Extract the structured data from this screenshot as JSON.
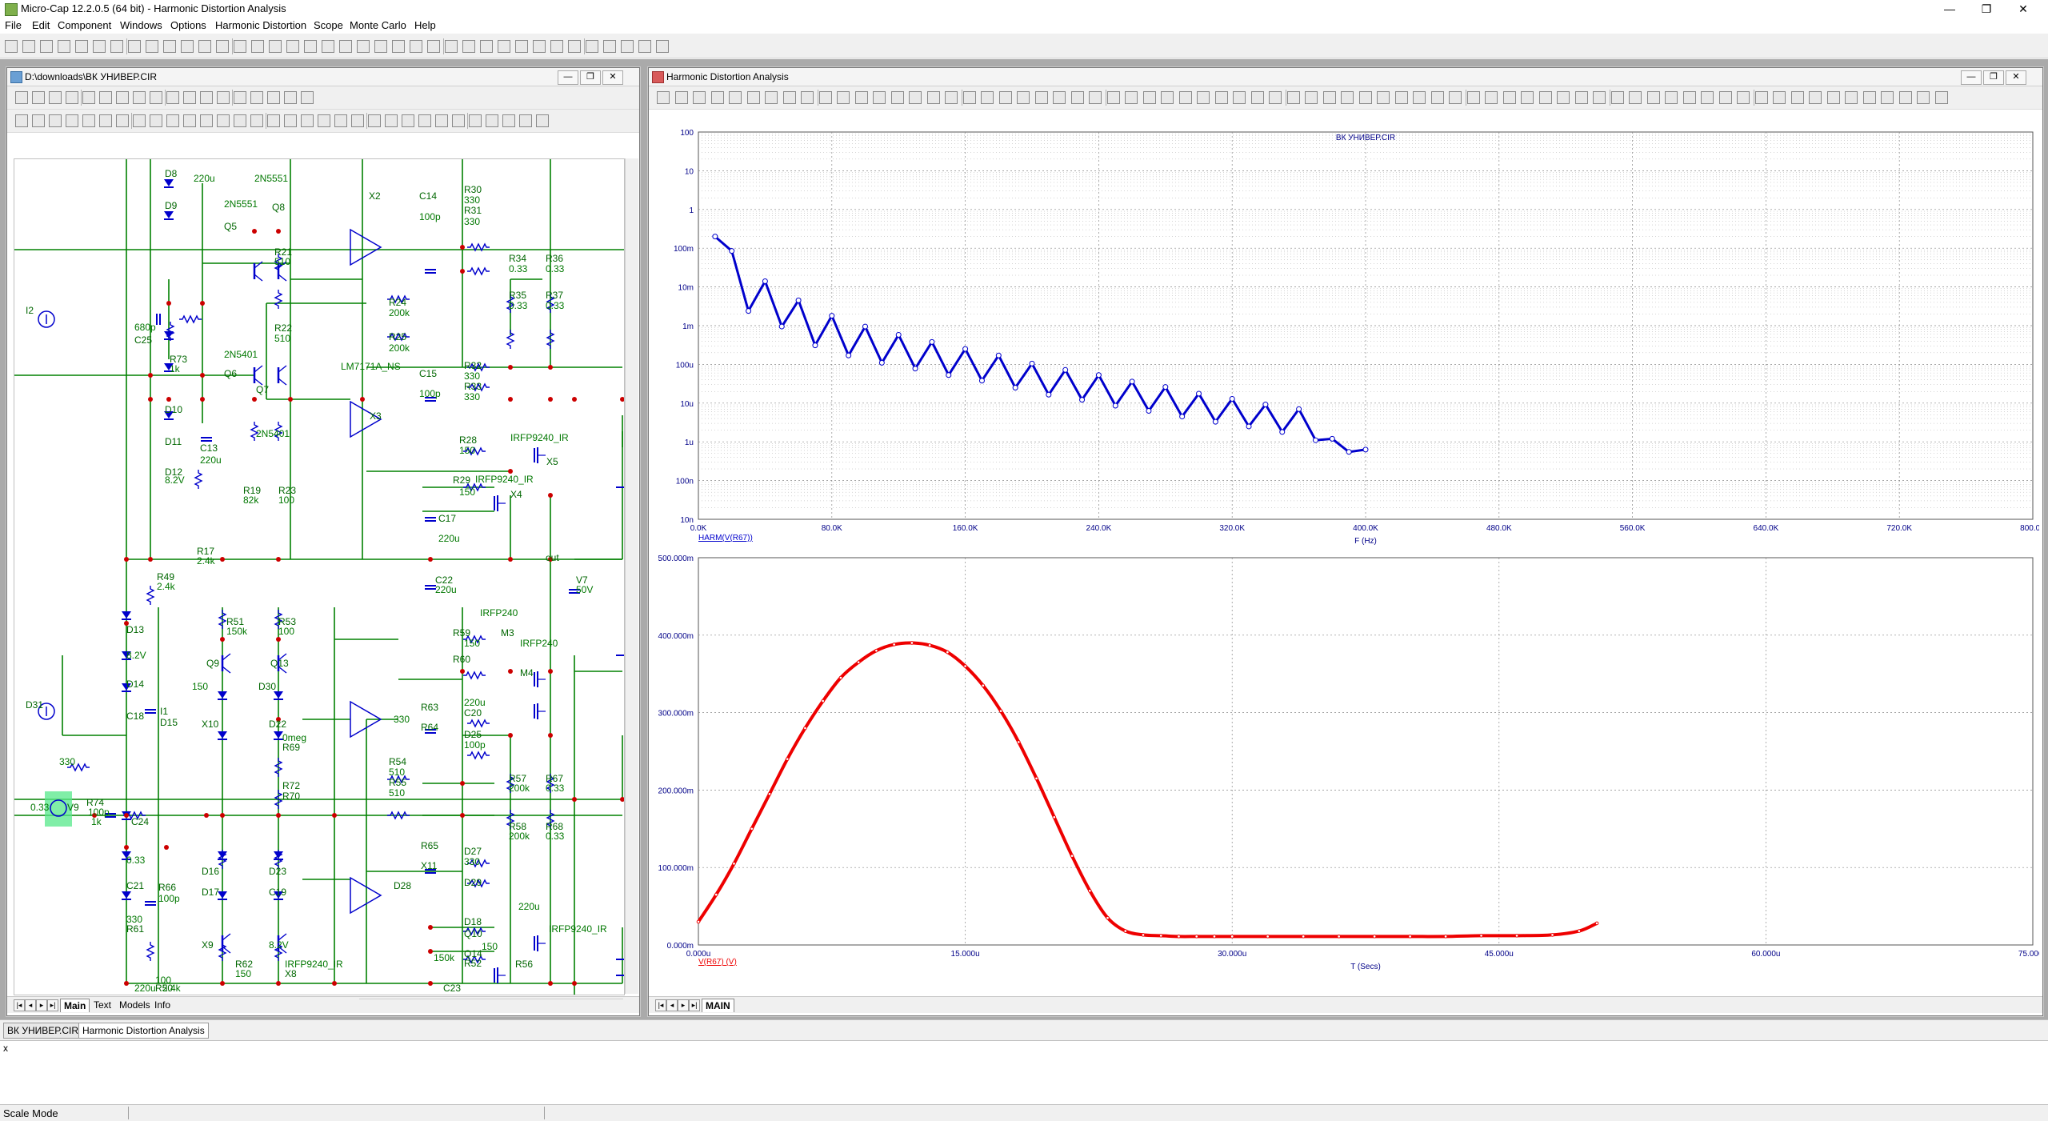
{
  "app": {
    "title": "Micro-Cap 12.2.0.5 (64 bit) - Harmonic Distortion Analysis",
    "window_buttons": [
      "—",
      "❐",
      "✕"
    ]
  },
  "menu": [
    "File",
    "Edit",
    "Component",
    "Windows",
    "Options",
    "Harmonic Distortion",
    "Scope",
    "Monte Carlo",
    "Help"
  ],
  "schematic_window": {
    "title": "D:\\downloads\\ВК УНИВЕР.CIR",
    "tabs": [
      "Main",
      "Text",
      "Models",
      "Info"
    ],
    "active_tab": "Main",
    "labels": [
      {
        "text": "D8",
        "kind": "part"
      },
      {
        "text": "220u",
        "kind": "value"
      },
      {
        "text": "2N5551",
        "kind": "value"
      },
      {
        "text": "D9",
        "kind": "part"
      },
      {
        "text": "2N5551",
        "kind": "value"
      },
      {
        "text": "Q8",
        "kind": "part"
      },
      {
        "text": "Q5",
        "kind": "part"
      },
      {
        "text": "R21",
        "kind": "part"
      },
      {
        "text": "510",
        "kind": "value"
      },
      {
        "text": "I2",
        "kind": "part"
      },
      {
        "text": "680p",
        "kind": "value"
      },
      {
        "text": "C25",
        "kind": "part"
      },
      {
        "text": "R73",
        "kind": "part"
      },
      {
        "text": "1k",
        "kind": "value"
      },
      {
        "text": "R22",
        "kind": "part"
      },
      {
        "text": "510",
        "kind": "value"
      },
      {
        "text": "2N5401",
        "kind": "value"
      },
      {
        "text": "Q6",
        "kind": "part"
      },
      {
        "text": "Q7",
        "kind": "part"
      },
      {
        "text": "2N5401",
        "kind": "value"
      },
      {
        "text": "D10",
        "kind": "part"
      },
      {
        "text": "D11",
        "kind": "part"
      },
      {
        "text": "C13",
        "kind": "part"
      },
      {
        "text": "220u",
        "kind": "value"
      },
      {
        "text": "D12",
        "kind": "part"
      },
      {
        "text": "8.2V",
        "kind": "value"
      },
      {
        "text": "R19",
        "kind": "part"
      },
      {
        "text": "82k",
        "kind": "value"
      },
      {
        "text": "R23",
        "kind": "part"
      },
      {
        "text": "100",
        "kind": "value"
      },
      {
        "text": "R17",
        "kind": "part"
      },
      {
        "text": "2.4k",
        "kind": "value"
      },
      {
        "text": "X2",
        "kind": "part"
      },
      {
        "text": "C14",
        "kind": "part"
      },
      {
        "text": "100p",
        "kind": "value"
      },
      {
        "text": "R24",
        "kind": "part"
      },
      {
        "text": "200k",
        "kind": "value"
      },
      {
        "text": "R25",
        "kind": "part"
      },
      {
        "text": "200k",
        "kind": "value"
      },
      {
        "text": "LM7171A_NS",
        "kind": "value"
      },
      {
        "text": "C15",
        "kind": "part"
      },
      {
        "text": "100p",
        "kind": "value"
      },
      {
        "text": "X3",
        "kind": "part"
      },
      {
        "text": "R30",
        "kind": "part"
      },
      {
        "text": "330",
        "kind": "value"
      },
      {
        "text": "R31",
        "kind": "part"
      },
      {
        "text": "330",
        "kind": "value"
      },
      {
        "text": "R34",
        "kind": "part"
      },
      {
        "text": "0.33",
        "kind": "value"
      },
      {
        "text": "R36",
        "kind": "part"
      },
      {
        "text": "0.33",
        "kind": "value"
      },
      {
        "text": "R35",
        "kind": "part"
      },
      {
        "text": "0.33",
        "kind": "value"
      },
      {
        "text": "R37",
        "kind": "part"
      },
      {
        "text": "0.33",
        "kind": "value"
      },
      {
        "text": "R32",
        "kind": "part"
      },
      {
        "text": "330",
        "kind": "value"
      },
      {
        "text": "R33",
        "kind": "part"
      },
      {
        "text": "330",
        "kind": "value"
      },
      {
        "text": "R28",
        "kind": "part"
      },
      {
        "text": "150",
        "kind": "value"
      },
      {
        "text": "IRFP9240_IR",
        "kind": "value"
      },
      {
        "text": "X5",
        "kind": "part"
      },
      {
        "text": "R29",
        "kind": "part"
      },
      {
        "text": "IRFP9240_IR",
        "kind": "value"
      },
      {
        "text": "150",
        "kind": "value"
      },
      {
        "text": "X4",
        "kind": "part"
      },
      {
        "text": "C17",
        "kind": "part"
      },
      {
        "text": "220u",
        "kind": "value"
      },
      {
        "text": "out",
        "kind": "part"
      },
      {
        "text": "R49",
        "kind": "part"
      },
      {
        "text": "2.4k",
        "kind": "value"
      },
      {
        "text": "C22",
        "kind": "part"
      },
      {
        "text": "220u",
        "kind": "value"
      },
      {
        "text": "V7",
        "kind": "part"
      },
      {
        "text": "50V",
        "kind": "value"
      },
      {
        "text": "R51",
        "kind": "part"
      },
      {
        "text": "150k",
        "kind": "value"
      },
      {
        "text": "R53",
        "kind": "part"
      },
      {
        "text": "100",
        "kind": "value"
      },
      {
        "text": "IRFP240",
        "kind": "value"
      },
      {
        "text": "D13",
        "kind": "part"
      },
      {
        "text": "R59",
        "kind": "part"
      },
      {
        "text": "M3",
        "kind": "part"
      },
      {
        "text": "150",
        "kind": "value"
      },
      {
        "text": "IRFP240",
        "kind": "value"
      },
      {
        "text": "8.2V",
        "kind": "value"
      },
      {
        "text": "Q9",
        "kind": "part"
      },
      {
        "text": "Q13",
        "kind": "part"
      },
      {
        "text": "R60",
        "kind": "part"
      },
      {
        "text": "M4",
        "kind": "part"
      },
      {
        "text": "D14",
        "kind": "part"
      },
      {
        "text": "150",
        "kind": "value"
      },
      {
        "text": "D30",
        "kind": "part"
      },
      {
        "text": "D31",
        "kind": "part"
      },
      {
        "text": "I1",
        "kind": "part"
      },
      {
        "text": "C18",
        "kind": "part"
      },
      {
        "text": "D15",
        "kind": "part"
      },
      {
        "text": "220u",
        "kind": "value"
      },
      {
        "text": "R63",
        "kind": "part"
      },
      {
        "text": "C20",
        "kind": "part"
      },
      {
        "text": "330",
        "kind": "value"
      },
      {
        "text": "X10",
        "kind": "part"
      },
      {
        "text": "D22",
        "kind": "part"
      },
      {
        "text": "D25",
        "kind": "part"
      },
      {
        "text": "R64",
        "kind": "part"
      },
      {
        "text": "100p",
        "kind": "value"
      },
      {
        "text": "330",
        "kind": "value"
      },
      {
        "text": "0meg",
        "kind": "value"
      },
      {
        "text": "R54",
        "kind": "part"
      },
      {
        "text": "R57",
        "kind": "part"
      },
      {
        "text": "R67",
        "kind": "part"
      },
      {
        "text": "R69",
        "kind": "part"
      },
      {
        "text": "510",
        "kind": "value"
      },
      {
        "text": "200k",
        "kind": "value"
      },
      {
        "text": "0.33",
        "kind": "value"
      },
      {
        "text": "0.33",
        "kind": "value"
      },
      {
        "text": "V9",
        "kind": "part"
      },
      {
        "text": "R74",
        "kind": "part"
      },
      {
        "text": "100p",
        "kind": "value"
      },
      {
        "text": "1k",
        "kind": "value"
      },
      {
        "text": "C24",
        "kind": "part"
      },
      {
        "text": "R72",
        "kind": "part"
      },
      {
        "text": "R55",
        "kind": "part"
      },
      {
        "text": "R58",
        "kind": "part"
      },
      {
        "text": "R68",
        "kind": "part"
      },
      {
        "text": "R70",
        "kind": "part"
      },
      {
        "text": "510",
        "kind": "value"
      },
      {
        "text": "200k",
        "kind": "value"
      },
      {
        "text": "0.33",
        "kind": "value"
      },
      {
        "text": "0.33",
        "kind": "value"
      },
      {
        "text": "D16",
        "kind": "part"
      },
      {
        "text": "D23",
        "kind": "part"
      },
      {
        "text": "D27",
        "kind": "part"
      },
      {
        "text": "R65",
        "kind": "part"
      },
      {
        "text": "330",
        "kind": "value"
      },
      {
        "text": "C21",
        "kind": "part"
      },
      {
        "text": "R66",
        "kind": "part"
      },
      {
        "text": "D17",
        "kind": "part"
      },
      {
        "text": "C19",
        "kind": "part"
      },
      {
        "text": "D28",
        "kind": "part"
      },
      {
        "text": "D29",
        "kind": "part"
      },
      {
        "text": "X11",
        "kind": "part"
      },
      {
        "text": "100p",
        "kind": "value"
      },
      {
        "text": "330",
        "kind": "value"
      },
      {
        "text": "220u",
        "kind": "value"
      },
      {
        "text": "D18",
        "kind": "part"
      },
      {
        "text": "IRFP9240_IR",
        "kind": "value"
      },
      {
        "text": "R61",
        "kind": "part"
      },
      {
        "text": "X9",
        "kind": "part"
      },
      {
        "text": "8.2V",
        "kind": "value"
      },
      {
        "text": "Q10",
        "kind": "part"
      },
      {
        "text": "Q14",
        "kind": "part"
      },
      {
        "text": "150",
        "kind": "value"
      },
      {
        "text": "R62",
        "kind": "part"
      },
      {
        "text": "IRFP9240_IR",
        "kind": "value"
      },
      {
        "text": "R52",
        "kind": "part"
      },
      {
        "text": "R56",
        "kind": "part"
      },
      {
        "text": "150",
        "kind": "value"
      },
      {
        "text": "X8",
        "kind": "part"
      },
      {
        "text": "150k",
        "kind": "value"
      },
      {
        "text": "100",
        "kind": "value"
      },
      {
        "text": "C23",
        "kind": "part"
      },
      {
        "text": "R50",
        "kind": "part"
      },
      {
        "text": "220u",
        "kind": "value"
      },
      {
        "text": "2.4k",
        "kind": "value"
      }
    ]
  },
  "analysis_window": {
    "title": "Harmonic Distortion Analysis",
    "tabs": [
      "MAIN"
    ],
    "active_tab": "MAIN"
  },
  "chart_data": [
    {
      "type": "line",
      "title": "ВК УНИВЕР.CIR",
      "series": [
        {
          "name": "HARM(V(R67))",
          "color": "#0000cc",
          "x": [
            10000,
            20000,
            30000,
            40000,
            50000,
            60000,
            70000,
            80000,
            90000,
            100000,
            110000,
            120000,
            130000,
            140000,
            150000,
            160000,
            170000,
            180000,
            190000,
            200000,
            210000,
            220000,
            230000,
            240000,
            250000,
            260000,
            270000,
            280000,
            290000,
            300000,
            310000,
            320000,
            330000,
            340000,
            350000,
            360000,
            370000,
            380000,
            390000,
            400000
          ],
          "y": [
            0.2,
            0.085,
            0.0024,
            0.014,
            0.00095,
            0.0045,
            0.00031,
            0.0018,
            0.00017,
            0.00095,
            0.00011,
            0.00058,
            7.8e-05,
            0.00038,
            5.3e-05,
            0.00025,
            3.8e-05,
            0.00017,
            2.5e-05,
            0.000105,
            1.65e-05,
            7.2e-05,
            1.22e-05,
            5.3e-05,
            8.6e-06,
            3.6e-05,
            6.3e-06,
            2.61e-05,
            4.5e-06,
            1.75e-05,
            3.3e-06,
            1.29e-05,
            2.5e-06,
            9.2e-06,
            1.8e-06,
            7e-06,
            1.1e-06,
            1.2e-06,
            5.5e-07,
            6.3e-07
          ]
        }
      ],
      "xlabel": "F (Hz)",
      "ylabel": "",
      "x_tick_labels": [
        "0.0K",
        "80.0K",
        "160.0K",
        "240.0K",
        "320.0K",
        "400.0K",
        "480.0K",
        "560.0K",
        "640.0K",
        "720.0K",
        "800.0K"
      ],
      "y_tick_labels": [
        "100",
        "10",
        "1",
        "100m",
        "10m",
        "1m",
        "100u",
        "10u",
        "1u",
        "100n",
        "10n"
      ],
      "xlim": [
        0,
        800000
      ],
      "ylim": [
        1e-08,
        100
      ],
      "y_scale": "log",
      "grid": true
    },
    {
      "type": "line",
      "title": "",
      "series": [
        {
          "name": "V(R67) (V)",
          "color": "#ee0000",
          "x": [
            0,
            1,
            2,
            3,
            4,
            5,
            6,
            7,
            8,
            9,
            10,
            11,
            12,
            13,
            14,
            15,
            16,
            17,
            18,
            19,
            20,
            21,
            22,
            23,
            24,
            25,
            26,
            27,
            28,
            29,
            30,
            32,
            34,
            36,
            38,
            40,
            42,
            44,
            46,
            48,
            49.5,
            50.5
          ],
          "y": [
            0.03,
            0.065,
            0.105,
            0.15,
            0.195,
            0.24,
            0.28,
            0.315,
            0.345,
            0.365,
            0.38,
            0.388,
            0.39,
            0.387,
            0.378,
            0.36,
            0.335,
            0.302,
            0.262,
            0.215,
            0.165,
            0.115,
            0.07,
            0.035,
            0.018,
            0.013,
            0.012,
            0.011,
            0.011,
            0.011,
            0.011,
            0.011,
            0.011,
            0.011,
            0.011,
            0.011,
            0.011,
            0.012,
            0.012,
            0.013,
            0.018,
            0.028
          ]
        }
      ],
      "xlabel": "T (Secs)",
      "ylabel": "",
      "x_tick_labels": [
        "0.000u",
        "15.000u",
        "30.000u",
        "45.000u",
        "60.000u",
        "75.000u"
      ],
      "y_tick_labels": [
        "0.000m",
        "100.000m",
        "200.000m",
        "300.000m",
        "400.000m",
        "500.000m"
      ],
      "xlim": [
        0,
        75
      ],
      "ylim": [
        0,
        0.5
      ],
      "grid": true
    }
  ],
  "document_tabs": [
    "ВК УНИВЕР.CIR",
    "Harmonic Distortion Analysis"
  ],
  "active_document_tab": "Harmonic Distortion Analysis",
  "output_panel": {
    "close": "x"
  },
  "status": {
    "mode": "Scale Mode"
  }
}
